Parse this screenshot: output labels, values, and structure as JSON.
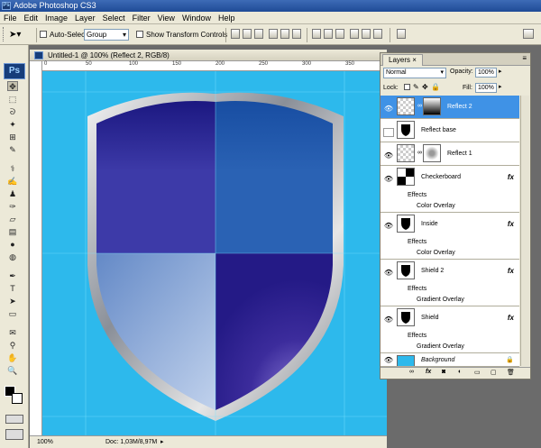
{
  "app": {
    "title": "Adobe Photoshop CS3",
    "logo": "Ps"
  },
  "menu": [
    "File",
    "Edit",
    "Image",
    "Layer",
    "Select",
    "Filter",
    "View",
    "Window",
    "Help"
  ],
  "options": {
    "auto_select_label": "Auto-Select:",
    "auto_select_value": "Group",
    "show_transform_label": "Show Transform Controls"
  },
  "document": {
    "title": "Untitled-1 @ 100% (Reflect 2, RGB/8)",
    "zoom": "100%",
    "doc_info": "Doc: 1,03M/8,97M",
    "ruler_marks": [
      "0",
      "50",
      "100",
      "150",
      "200",
      "250",
      "300",
      "350"
    ]
  },
  "layers_panel": {
    "tab": "Layers",
    "blend_mode": "Normal",
    "opacity_label": "Opacity:",
    "opacity": "100%",
    "lock_label": "Lock:",
    "fill_label": "Fill:",
    "fill": "100%",
    "layers": [
      {
        "name": "Reflect 2",
        "visible": true,
        "active": true
      },
      {
        "name": "Reflect base",
        "visible": false
      },
      {
        "name": "Reflect 1",
        "visible": true
      },
      {
        "name": "Checkerboard",
        "visible": true,
        "effects_label": "Effects",
        "effect": "Color Overlay"
      },
      {
        "name": "Inside",
        "visible": true,
        "effects_label": "Effects",
        "effect": "Color Overlay"
      },
      {
        "name": "Shield 2",
        "visible": true,
        "effects_label": "Effects",
        "effect": "Gradient Overlay"
      },
      {
        "name": "Shield",
        "visible": true,
        "effects_label": "Effects",
        "effect": "Gradient Overlay"
      },
      {
        "name": "Background",
        "visible": true
      }
    ],
    "fx_label": "fx"
  },
  "colors": {
    "canvas": "#2db9ec",
    "shield_dark": "#1a1a7a",
    "shield_blue": "#1f5bb0",
    "active_layer": "#3f92e6"
  }
}
